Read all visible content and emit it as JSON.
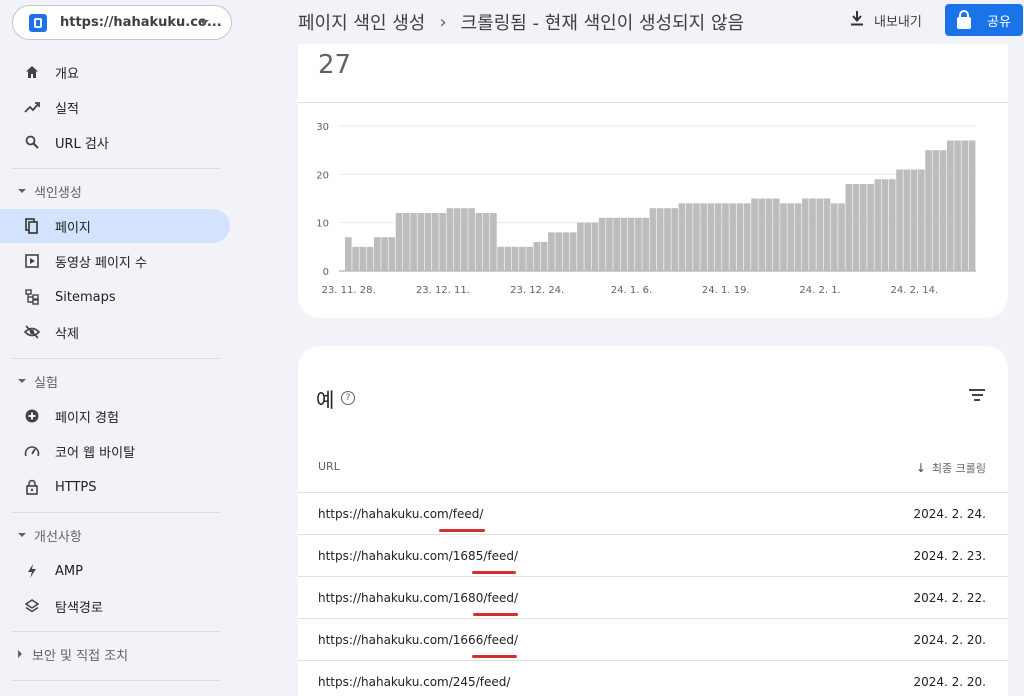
{
  "property": {
    "label": "https://hahakuku.co..."
  },
  "sidebar": {
    "top_items": [
      {
        "label": "개요",
        "icon": "home-icon"
      },
      {
        "label": "실적",
        "icon": "trending-up-icon"
      },
      {
        "label": "URL 검사",
        "icon": "search-icon"
      }
    ],
    "sections": [
      {
        "title": "색인생성",
        "items": [
          {
            "label": "페이지",
            "icon": "pages-icon",
            "active": true
          },
          {
            "label": "동영상 페이지 수",
            "icon": "video-page-icon"
          },
          {
            "label": "Sitemaps",
            "icon": "sitemap-icon"
          },
          {
            "label": "삭제",
            "icon": "visibility-off-icon"
          }
        ]
      },
      {
        "title": "실험",
        "items": [
          {
            "label": "페이지 경험",
            "icon": "add-circle-icon"
          },
          {
            "label": "코어 웹 바이탈",
            "icon": "speed-icon"
          },
          {
            "label": "HTTPS",
            "icon": "lock-icon"
          }
        ]
      },
      {
        "title": "개선사항",
        "items": [
          {
            "label": "AMP",
            "icon": "bolt-icon"
          },
          {
            "label": "탐색경로",
            "icon": "layers-icon"
          }
        ]
      },
      {
        "title": "보안 및 직접 조치",
        "items": []
      }
    ]
  },
  "header": {
    "breadcrumb_parent": "페이지 색인 생성",
    "breadcrumb_sep": "›",
    "breadcrumb_current": "크롤링됨 - 현재 색인이 생성되지 않음",
    "export_label": "내보내기",
    "share_label": "공유"
  },
  "summary": {
    "count": "27"
  },
  "chart_data": {
    "type": "bar",
    "ylim": [
      0,
      30
    ],
    "yticks": [
      0,
      10,
      20,
      30
    ],
    "grid": true,
    "xtick_labels": [
      "23. 11. 28.",
      "23. 12. 11.",
      "23. 12. 24.",
      "24. 1. 6.",
      "24. 1. 19.",
      "24. 2. 1.",
      "24. 2. 14."
    ],
    "xtick_indices": [
      0,
      13,
      26,
      39,
      52,
      65,
      78
    ],
    "values": [
      7,
      5,
      5,
      5,
      7,
      7,
      7,
      12,
      12,
      12,
      12,
      12,
      12,
      12,
      13,
      13,
      13,
      13,
      12,
      12,
      12,
      5,
      5,
      5,
      5,
      5,
      6,
      6,
      8,
      8,
      8,
      8,
      10,
      10,
      10,
      11,
      11,
      11,
      11,
      11,
      11,
      11,
      13,
      13,
      13,
      13,
      14,
      14,
      14,
      14,
      14,
      14,
      14,
      14,
      14,
      14,
      15,
      15,
      15,
      15,
      14,
      14,
      14,
      15,
      15,
      15,
      15,
      14,
      14,
      18,
      18,
      18,
      18,
      19,
      19,
      19,
      21,
      21,
      21,
      21,
      25,
      25,
      25,
      27,
      27,
      27,
      27
    ],
    "bar_color": "#bdbdbd"
  },
  "examples": {
    "title": "예",
    "col_url": "URL",
    "col_date": "최종 크롤링",
    "rows": [
      {
        "url": "https://hahakuku.com/feed/",
        "date": "2024. 2. 24."
      },
      {
        "url": "https://hahakuku.com/1685/feed/",
        "date": "2024. 2. 23."
      },
      {
        "url": "https://hahakuku.com/1680/feed/",
        "date": "2024. 2. 22."
      },
      {
        "url": "https://hahakuku.com/1666/feed/",
        "date": "2024. 2. 20."
      },
      {
        "url": "https://hahakuku.com/245/feed/",
        "date": "2024. 2. 20."
      }
    ],
    "highlight_color": "#d32f2f"
  }
}
